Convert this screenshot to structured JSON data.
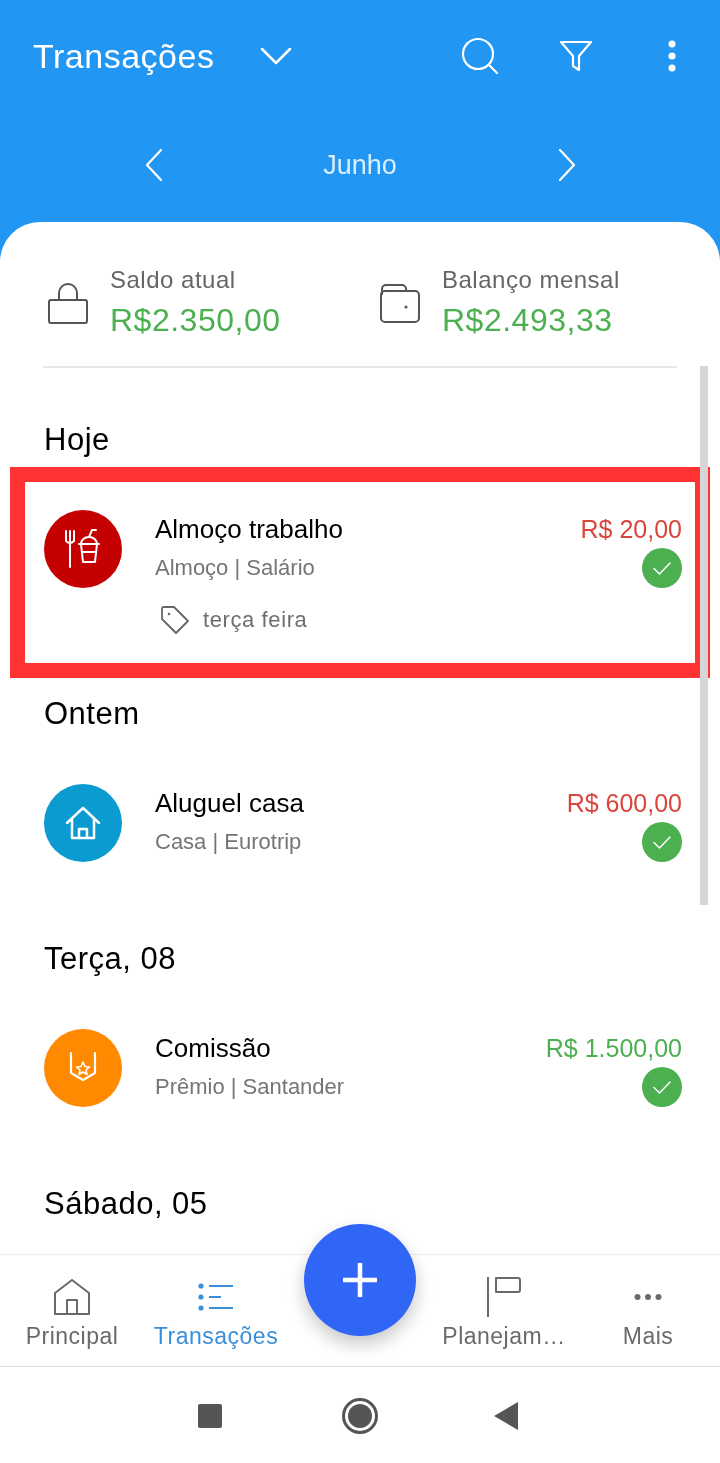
{
  "app_bar": {
    "title": "Transações"
  },
  "month_nav": {
    "label": "Junho"
  },
  "summary": [
    {
      "kind": "lock",
      "label": "Saldo atual",
      "value": "R$2.350,00"
    },
    {
      "kind": "wallet",
      "label": "Balanço mensal",
      "value": "R$2.493,33"
    }
  ],
  "sections": [
    {
      "heading": "Hoje",
      "transactions": [
        {
          "kind": "food",
          "color": "#c40000",
          "title": "Almoço trabalho",
          "subtitle": "Almoço | Salário",
          "tag": "terça feira",
          "amount": "R$ 20,00",
          "income": false,
          "paid": true,
          "highlighted": true
        }
      ]
    },
    {
      "heading": "Ontem",
      "transactions": [
        {
          "kind": "house",
          "color": "#0b9bd0",
          "title": "Aluguel casa",
          "subtitle": "Casa | Eurotrip",
          "amount": "R$ 600,00",
          "income": false,
          "paid": true,
          "highlighted": false
        }
      ]
    },
    {
      "heading": "Terça, 08",
      "transactions": [
        {
          "kind": "award",
          "color": "#ff8a00",
          "title": "Comissão",
          "subtitle": "Prêmio | Santander",
          "amount": "R$ 1.500,00",
          "income": true,
          "paid": true,
          "highlighted": false
        }
      ]
    },
    {
      "heading": "Sábado, 05"
    }
  ],
  "bottom_nav": {
    "items": [
      {
        "kind": "home",
        "label": "Principal",
        "selected": false
      },
      {
        "kind": "list",
        "label": "Transações",
        "selected": true
      },
      {
        "kind": "flag",
        "label": "Planejam…",
        "selected": false
      },
      {
        "kind": "more",
        "label": "Mais",
        "selected": false
      }
    ]
  }
}
